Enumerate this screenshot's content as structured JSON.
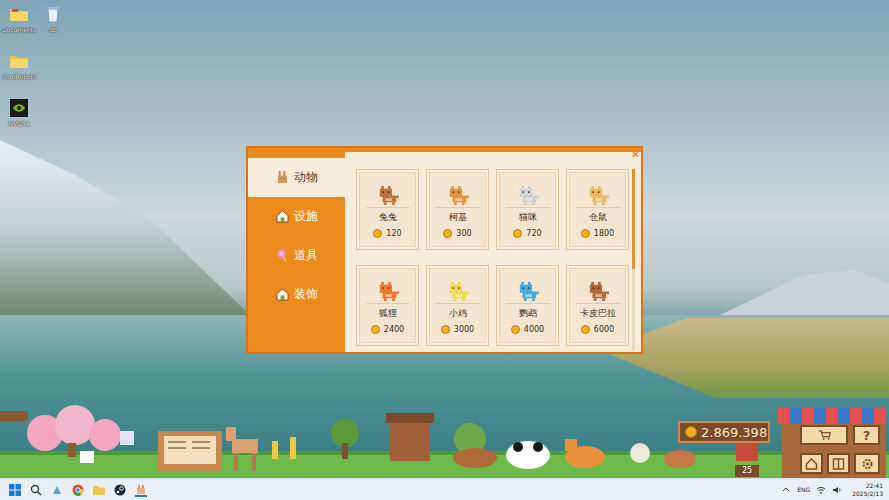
{
  "desktop_icons": [
    {
      "label": "Documents",
      "kind": "folder"
    },
    {
      "label": "db",
      "kind": "bin"
    },
    {
      "label": "ShotRobots",
      "kind": "folder"
    },
    {
      "label": "NVIDIA",
      "kind": "nvidia"
    }
  ],
  "shop": {
    "close": "✕",
    "categories": [
      {
        "label": "动物",
        "selected": true
      },
      {
        "label": "设施",
        "selected": false
      },
      {
        "label": "道具",
        "selected": false
      },
      {
        "label": "装饰",
        "selected": false
      }
    ],
    "items": [
      {
        "name": "兔兔",
        "price": "120",
        "color": "#b8733e"
      },
      {
        "name": "柯基",
        "price": "300",
        "color": "#e0953a"
      },
      {
        "name": "猫咪",
        "price": "720",
        "color": "#cfcfcf"
      },
      {
        "name": "仓鼠",
        "price": "1800",
        "color": "#e8b860"
      },
      {
        "name": "狐狸",
        "price": "2400",
        "color": "#e8782a"
      },
      {
        "name": "小鸡",
        "price": "3000",
        "color": "#f0d850"
      },
      {
        "name": "鹦鹉",
        "price": "4000",
        "color": "#4aa8d8"
      },
      {
        "name": "卡皮巴拉",
        "price": "6000",
        "color": "#b06a3a"
      }
    ],
    "scrollbar": {
      "level": 0.55
    }
  },
  "game_bar": {
    "coins": "2.869.398",
    "badge": "25",
    "help": "?"
  },
  "taskbar": {
    "language": "ENG",
    "time": "22:41",
    "date": "2025/2/13"
  }
}
